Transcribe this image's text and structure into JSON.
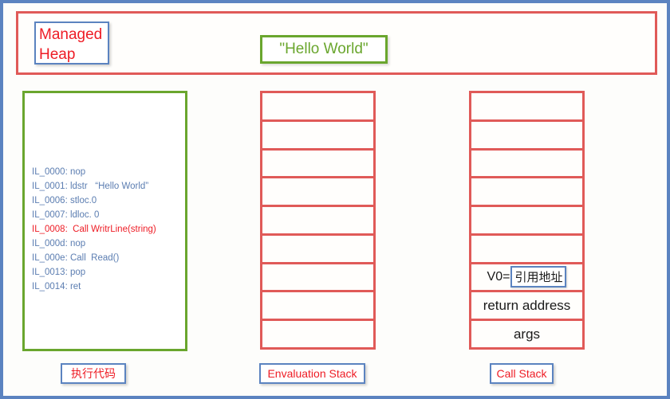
{
  "page": {
    "border_color": "#5b83c0",
    "background": "#fdfdfb"
  },
  "heap": {
    "container_border_color": "#e05a58",
    "label": "Managed\nHeap",
    "label_color": "#ee1c25",
    "label_border_color": "#5b83c0",
    "string_object": "\"Hello World\"",
    "string_object_color": "#6aa62e",
    "string_object_border_color": "#6aa62e"
  },
  "code_panel": {
    "border_color": "#6aa62e",
    "text_color": "#5b7db1",
    "highlight_color": "#ee1c25",
    "lines": [
      {
        "text": "IL_0000: nop",
        "highlighted": false
      },
      {
        "text": "IL_0001: ldstr   “Hello World”",
        "highlighted": false
      },
      {
        "text": "IL_0006: stloc.0",
        "highlighted": false
      },
      {
        "text": "IL_0007: ldloc. 0",
        "highlighted": false
      },
      {
        "text": "IL_0008:  Call WritrLine(string)",
        "highlighted": true
      },
      {
        "text": "IL_000d: nop",
        "highlighted": false
      },
      {
        "text": "IL_000e: Call  Read()",
        "highlighted": false
      },
      {
        "text": "IL_0013: pop",
        "highlighted": false
      },
      {
        "text": "IL_0014: ret",
        "highlighted": false
      }
    ]
  },
  "evaluation_stack": {
    "border_color": "#e05a58",
    "cell_count": 9,
    "cells": [
      "",
      "",
      "",
      "",
      "",
      "",
      "",
      "",
      ""
    ]
  },
  "call_stack": {
    "border_color": "#e05a58",
    "cell_count": 9,
    "cells": [
      "",
      "",
      "",
      "",
      "",
      "",
      "V0=",
      "return address",
      "args"
    ],
    "v0_reference_value": "引用地址",
    "v0_reference_border_color": "#5b83c0"
  },
  "captions": {
    "code": "执行代码",
    "evaluation_stack": "Envaluation  Stack",
    "call_stack": "Call Stack",
    "text_color": "#ee1c25",
    "border_color": "#5b83c0"
  }
}
